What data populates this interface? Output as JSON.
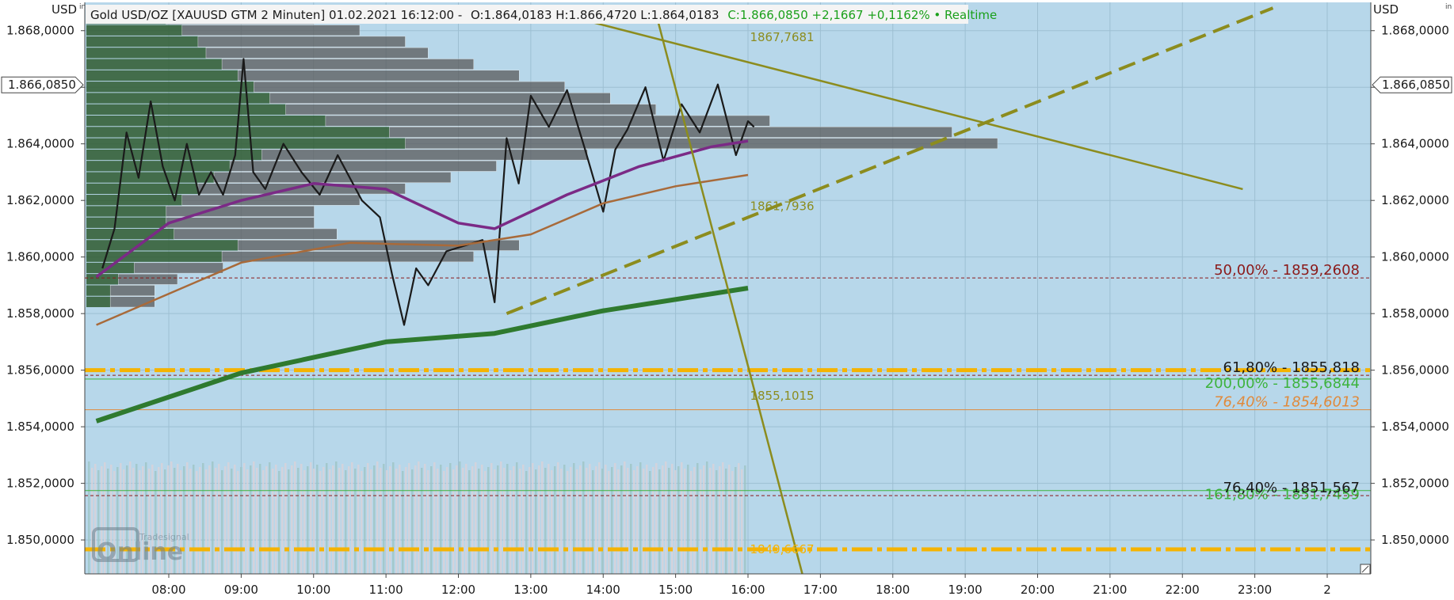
{
  "header": {
    "title": "Gold USD/OZ [XAUUSD GTM 2 Minuten] 01.02.2021 16:12:00 -",
    "ohlc": "O:1.864,0183 H:1.866,4720 L:1.864,0183",
    "close": "C:1.866,0850 +2,1667 +0,1162% • Realtime"
  },
  "axis": {
    "left_unit": "USD",
    "right_unit": "USD",
    "current_price_label": "1.866,0850"
  },
  "watermark": {
    "brand": "Tradesignal",
    "name": "Online"
  },
  "colors": {
    "plot_bg": "#b7d7ea",
    "price": "#1a1a1a",
    "trend": "#8c8c1e",
    "vwap": "#2f7a2f",
    "fib_orange": "#f5b300",
    "fib_red": "#8b1a1a",
    "fib_green": "#3db33d",
    "fib_light_orange": "#e08a3c"
  },
  "chart_data": {
    "type": "line",
    "title": "Gold USD/OZ [XAUUSD GTM 2 Minuten]",
    "ylabel": "USD",
    "ylim": [
      1848.8,
      1869.0
    ],
    "yticks": [
      1850,
      1852,
      1854,
      1856,
      1858,
      1860,
      1862,
      1864,
      1866,
      1868
    ],
    "ytick_labels": [
      "1.850,0000",
      "1.852,0000",
      "1.854,0000",
      "1.856,0000",
      "1.858,0000",
      "1.860,0000",
      "1.862,0000",
      "1.864,0000",
      "1.866,0000",
      "1.868,0000"
    ],
    "x_tick_labels": [
      "08:00",
      "09:00",
      "10:00",
      "11:00",
      "12:00",
      "13:00",
      "14:00",
      "15:00",
      "16:00",
      "17:00",
      "18:00",
      "19:00",
      "20:00",
      "21:00",
      "22:00",
      "23:00",
      "2"
    ],
    "series": [
      {
        "kind": "price",
        "points": [
          [
            "07:05",
            1859.6
          ],
          [
            "07:15",
            1861.0
          ],
          [
            "07:25",
            1864.4
          ],
          [
            "07:35",
            1862.8
          ],
          [
            "07:45",
            1865.5
          ],
          [
            "07:55",
            1863.2
          ],
          [
            "08:05",
            1862.0
          ],
          [
            "08:15",
            1864.0
          ],
          [
            "08:25",
            1862.2
          ],
          [
            "08:35",
            1863.0
          ],
          [
            "08:45",
            1862.2
          ],
          [
            "08:55",
            1863.6
          ],
          [
            "09:02",
            1867.0
          ],
          [
            "09:10",
            1863.0
          ],
          [
            "09:20",
            1862.4
          ],
          [
            "09:35",
            1864.0
          ],
          [
            "09:50",
            1863.0
          ],
          [
            "10:05",
            1862.2
          ],
          [
            "10:20",
            1863.6
          ],
          [
            "10:40",
            1862.0
          ],
          [
            "10:55",
            1861.4
          ],
          [
            "11:05",
            1859.4
          ],
          [
            "11:15",
            1857.6
          ],
          [
            "11:25",
            1859.6
          ],
          [
            "11:35",
            1859.0
          ],
          [
            "11:50",
            1860.2
          ],
          [
            "12:05",
            1860.4
          ],
          [
            "12:20",
            1860.6
          ],
          [
            "12:30",
            1858.4
          ],
          [
            "12:40",
            1864.2
          ],
          [
            "12:50",
            1862.6
          ],
          [
            "13:00",
            1865.7
          ],
          [
            "13:15",
            1864.6
          ],
          [
            "13:30",
            1865.9
          ],
          [
            "13:45",
            1863.8
          ],
          [
            "14:00",
            1861.6
          ],
          [
            "14:10",
            1863.8
          ],
          [
            "14:20",
            1864.5
          ],
          [
            "14:35",
            1866.0
          ],
          [
            "14:50",
            1863.4
          ],
          [
            "15:05",
            1865.4
          ],
          [
            "15:20",
            1864.4
          ],
          [
            "15:35",
            1866.1
          ],
          [
            "15:50",
            1863.6
          ],
          [
            "16:00",
            1864.8
          ],
          [
            "16:05",
            1864.6
          ]
        ]
      },
      {
        "kind": "vwap",
        "points": [
          [
            "07:00",
            1854.2
          ],
          [
            "09:00",
            1855.9
          ],
          [
            "11:00",
            1857.0
          ],
          [
            "12:30",
            1857.3
          ],
          [
            "14:00",
            1858.1
          ],
          [
            "16:00",
            1858.9
          ]
        ]
      },
      {
        "kind": "ma",
        "points": [
          [
            "07:00",
            1857.6
          ],
          [
            "09:00",
            1859.8
          ],
          [
            "10:30",
            1860.5
          ],
          [
            "12:00",
            1860.4
          ],
          [
            "13:00",
            1860.8
          ],
          [
            "14:00",
            1861.9
          ],
          [
            "15:00",
            1862.5
          ],
          [
            "16:00",
            1862.9
          ]
        ]
      },
      {
        "kind": "ma",
        "points": [
          [
            "07:00",
            1859.3
          ],
          [
            "08:00",
            1861.2
          ],
          [
            "09:00",
            1862.0
          ],
          [
            "10:00",
            1862.6
          ],
          [
            "11:00",
            1862.4
          ],
          [
            "12:00",
            1861.2
          ],
          [
            "12:30",
            1861.0
          ],
          [
            "13:30",
            1862.2
          ],
          [
            "14:30",
            1863.2
          ],
          [
            "15:30",
            1863.9
          ],
          [
            "16:00",
            1864.1
          ]
        ]
      }
    ],
    "trendlines": [
      {
        "from": [
          "13:05",
          1868.8
        ],
        "to": [
          "22:50",
          1862.4
        ],
        "style": "solid"
      },
      {
        "from": [
          "14:45",
          1868.4
        ],
        "to": [
          "16:45",
          1848.8
        ],
        "style": "solid"
      },
      {
        "from": [
          "12:40",
          1858.0
        ],
        "to": [
          "23:15",
          1868.8
        ],
        "style": "dashed"
      }
    ],
    "horizontal_levels": [
      {
        "y": 1859.2608,
        "label": "50,00% - 1859,2608",
        "style": "dashed"
      },
      {
        "y": 1856.0,
        "label": "",
        "style": "dashdot"
      },
      {
        "y": 1855.818,
        "label": "61,80% - 1855,818",
        "style": "dashed"
      },
      {
        "y": 1855.6844,
        "label": "200,00% - 1855,6844",
        "style": "solid"
      },
      {
        "y": 1854.6013,
        "label": "76,40% - 1854,6013",
        "style": "solid"
      },
      {
        "y": 1851.7459,
        "label": "161,80% - 1851,7459",
        "style": "solid"
      },
      {
        "y": 1851.567,
        "label": "76,40% - 1851,567",
        "style": "dashed"
      },
      {
        "y": 1849.6667,
        "label": "",
        "style": "dashdot"
      }
    ],
    "annotations": [
      {
        "x": "15:59",
        "y": 1867.7681,
        "text": "1867,7681"
      },
      {
        "x": "15:59",
        "y": 1861.7936,
        "text": "1861,7936"
      },
      {
        "x": "15:59",
        "y": 1855.1015,
        "text": "1855,1015"
      },
      {
        "x": "15:59",
        "y": 1849.6667,
        "text": "1849,6667"
      }
    ],
    "current_price": 1866.085,
    "volume_profile": [
      [
        1868.6,
        0.5
      ],
      [
        1868.2,
        0.6
      ],
      [
        1867.8,
        0.7
      ],
      [
        1867.4,
        0.75
      ],
      [
        1867.0,
        0.85
      ],
      [
        1866.6,
        0.95
      ],
      [
        1866.2,
        1.05
      ],
      [
        1865.8,
        1.15
      ],
      [
        1865.4,
        1.25
      ],
      [
        1865.0,
        1.5
      ],
      [
        1864.6,
        1.9
      ],
      [
        1864.2,
        2.0
      ],
      [
        1863.8,
        1.1
      ],
      [
        1863.4,
        0.9
      ],
      [
        1863.0,
        0.8
      ],
      [
        1862.6,
        0.7
      ],
      [
        1862.2,
        0.6
      ],
      [
        1861.8,
        0.5
      ],
      [
        1861.4,
        0.5
      ],
      [
        1861.0,
        0.55
      ],
      [
        1860.6,
        0.95
      ],
      [
        1860.2,
        0.85
      ],
      [
        1859.8,
        0.3
      ],
      [
        1859.4,
        0.2
      ],
      [
        1859.0,
        0.15
      ],
      [
        1858.6,
        0.15
      ]
    ]
  }
}
